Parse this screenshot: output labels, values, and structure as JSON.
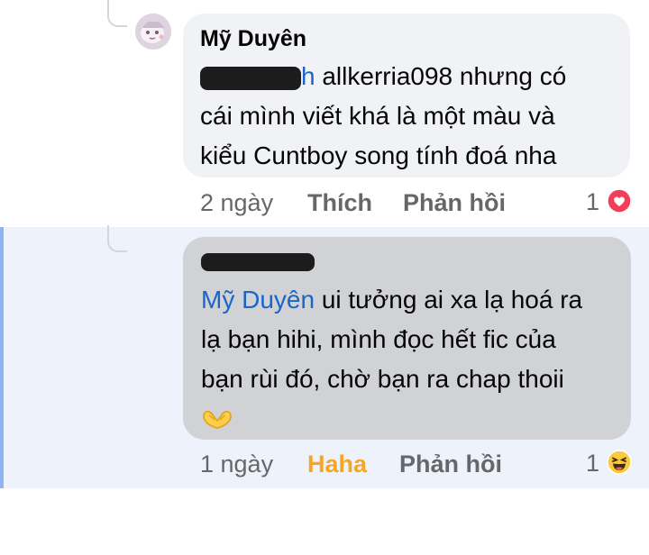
{
  "comment_1": {
    "author": "Mỹ Duyên",
    "mention_tail": "h",
    "text_line_1": " allkerria098 nhưng có",
    "text_line_2": "cái mình viết khá là một màu và",
    "text_line_3": "kiểu Cuntboy song tính đoá nha",
    "time": "2 ngày",
    "like_label": "Thích",
    "reply_label": "Phản hồi",
    "reaction_count": "1",
    "reaction_icon": "love-heart-icon"
  },
  "comment_2": {
    "mention": "Mỹ Duyên",
    "text_line_1": " ui tưởng ai xa lạ hoá ra",
    "text_line_2": "lạ bạn hihi, mình đọc hết fic của",
    "text_line_3": "bạn rùi đó, chờ bạn ra chap thoii",
    "emoji": "🫶",
    "time": "1 ngày",
    "reaction_label": "Haha",
    "reply_label": "Phản hồi",
    "reaction_count": "1",
    "reaction_icon": "haha-laugh-icon"
  },
  "colors": {
    "mention": "#1a66c7",
    "haha": "#f5a623",
    "love": "#f33e58",
    "highlight_bg": "#eef3fb",
    "highlight_edge": "#8fb4ee"
  }
}
